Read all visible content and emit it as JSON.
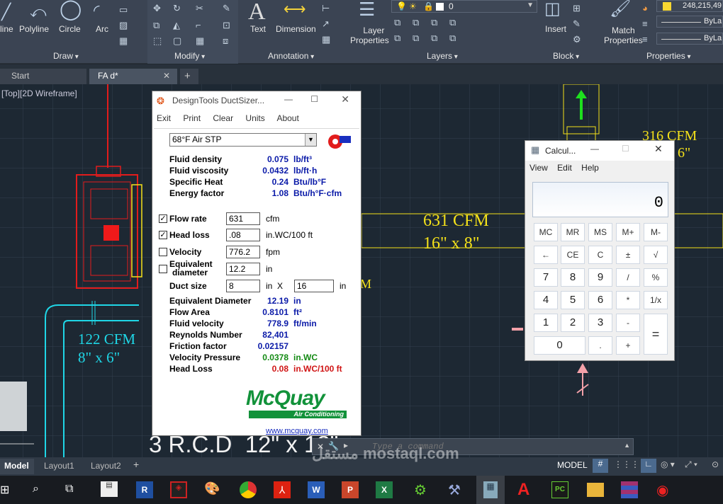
{
  "ribbon": {
    "draw_tools": [
      "line",
      "Polyline",
      "Circle",
      "Arc"
    ],
    "text_tool": "Text",
    "dimension_tool": "Dimension",
    "layer_properties": [
      "Layer",
      "Properties"
    ],
    "layer_value": "0",
    "insert_tool": "Insert",
    "match_properties": [
      "Match",
      "Properties"
    ],
    "color_value": "248,215,49",
    "linetype_1": "ByLa",
    "linetype_2": "ByLa",
    "panels": [
      "Draw",
      "Modify",
      "Annotation",
      "Layers",
      "Block",
      "Properties"
    ]
  },
  "doc_tabs": {
    "start": "Start",
    "active": "FA d*"
  },
  "viewport_label": "[Top][2D Wireframe]",
  "cad_texts": {
    "cfm_631": "631 CFM",
    "size_16x8": "16\" x 8\"",
    "cfm_316": "316 CFM",
    "size_6": "6\"",
    "cfm_122": "122 CFM",
    "size_8x6": "8\" x 6\"",
    "rcd_label": "3 R.C.D  12\" x 12\"",
    "partial_m": "M"
  },
  "command_line": {
    "placeholder": "Type a command"
  },
  "layout_tabs": [
    "Model",
    "Layout1",
    "Layout2"
  ],
  "model_label": "MODEL",
  "duct_sizer": {
    "title": "DesignTools DuctSizer...",
    "menu": [
      "Exit",
      "Print",
      "Clear",
      "Units",
      "About"
    ],
    "fluid": "68°F Air STP",
    "props": [
      {
        "label": "Fluid density",
        "value": "0.075",
        "unit": "lb/ft³"
      },
      {
        "label": "Fluid viscosity",
        "value": "0.0432",
        "unit": "lb/ft·h"
      },
      {
        "label": "Specific Heat",
        "value": "0.24",
        "unit": "Btu/lb°F"
      },
      {
        "label": "Energy factor",
        "value": "1.08",
        "unit": "Btu/h°F·cfm"
      }
    ],
    "inputs": {
      "flow_rate": {
        "label": "Flow rate",
        "value": "631",
        "unit": "cfm",
        "checked": true
      },
      "head_loss": {
        "label": "Head loss",
        "value": ".08",
        "unit": "in.WC/100 ft",
        "checked": true
      },
      "velocity": {
        "label": "Velocity",
        "value": "776.2",
        "unit": "fpm",
        "checked": false
      },
      "equiv_diam": {
        "label1": "Equivalent",
        "label2": "diameter",
        "value": "12.2",
        "unit": "in",
        "checked": false
      },
      "duct_size": {
        "label": "Duct size",
        "w": "8",
        "x": "in  X",
        "h": "16",
        "unit": "in"
      }
    },
    "results": [
      {
        "label": "Equivalent Diameter",
        "value": "12.19",
        "unit": "in",
        "color": "#0a1aa8"
      },
      {
        "label": "Flow Area",
        "value": "0.8101",
        "unit": "ft²",
        "color": "#0a1aa8"
      },
      {
        "label": "Fluid velocity",
        "value": "778.9",
        "unit": "ft/min",
        "color": "#0a1aa8"
      },
      {
        "label": "Reynolds Number",
        "value": "82,401",
        "unit": "",
        "color": "#0a1aa8"
      },
      {
        "label": "Friction factor",
        "value": "0.02157",
        "unit": "",
        "color": "#0a1aa8"
      },
      {
        "label": "Velocity Pressure",
        "value": "0.0378",
        "unit": "in.WC",
        "color": "#138a13"
      },
      {
        "label": "Head Loss",
        "value": "0.08",
        "unit": "in.WC/100 ft",
        "color": "#d01515"
      }
    ],
    "logo": "McQuay",
    "logo_sub": "Air Conditioning",
    "url": "www.mcquay.com"
  },
  "calculator": {
    "title": "Calcul...",
    "menu": [
      "View",
      "Edit",
      "Help"
    ],
    "display": "0",
    "mem": [
      "MC",
      "MR",
      "MS",
      "M+",
      "M-"
    ],
    "row2": [
      "←",
      "CE",
      "C",
      "±",
      "√"
    ],
    "row3": [
      "7",
      "8",
      "9",
      "/",
      "%"
    ],
    "row4": [
      "4",
      "5",
      "6",
      "*",
      "1/x"
    ],
    "row5": [
      "1",
      "2",
      "3",
      "-"
    ],
    "row6": [
      "0",
      ".",
      "+"
    ],
    "equals": "="
  },
  "watermark": "مستقل mostaql.com"
}
